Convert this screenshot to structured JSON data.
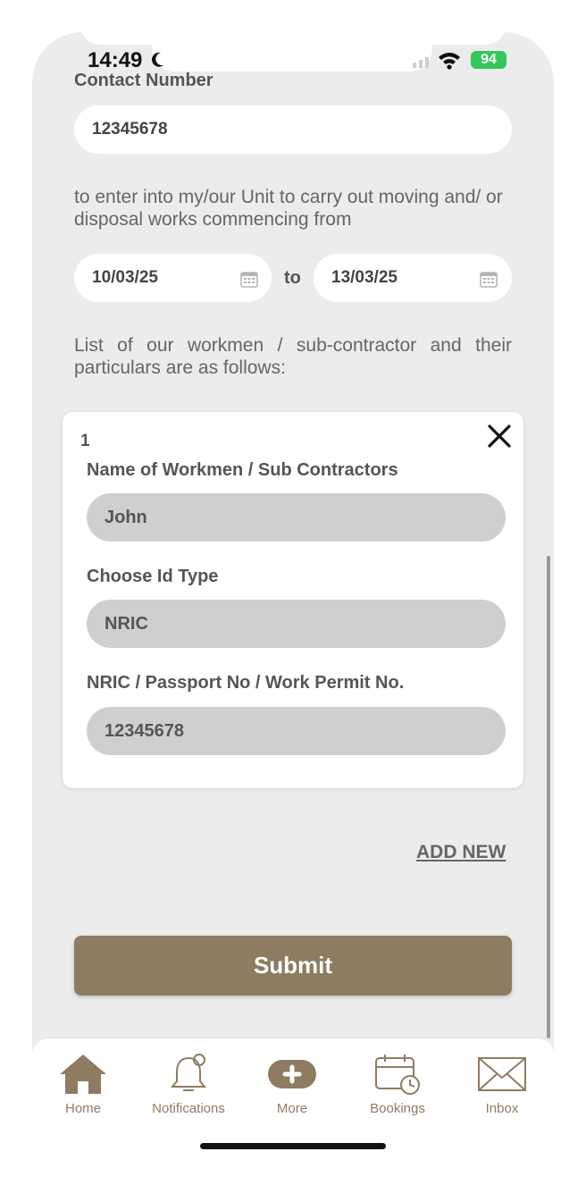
{
  "status_bar": {
    "time": "14:49",
    "battery": "94"
  },
  "form": {
    "contact_label": "Contact Number",
    "contact_value": "12345678",
    "intro_text": "to enter into my/our Unit to carry out moving and/ or disposal works commencing from",
    "date_from": "10/03/25",
    "date_to": "13/03/25",
    "to_label": "to",
    "list_text": "List of our workmen / sub-contractor and their particulars are as follows:"
  },
  "workman_card": {
    "index": "1",
    "name_label": "Name of Workmen / Sub Contractors",
    "name_value": "John",
    "id_type_label": "Choose Id Type",
    "id_type_value": "NRIC",
    "id_no_label": "NRIC / Passport No / Work Permit No.",
    "id_no_value": "12345678"
  },
  "actions": {
    "add_new": "ADD NEW",
    "submit": "Submit"
  },
  "tabbar": {
    "items": [
      {
        "label": "Home",
        "icon": "home-icon"
      },
      {
        "label": "Notifications",
        "icon": "bell-icon"
      },
      {
        "label": "More",
        "icon": "plus-pill-icon"
      },
      {
        "label": "Bookings",
        "icon": "calendar-clock-icon"
      },
      {
        "label": "Inbox",
        "icon": "envelope-icon"
      }
    ]
  },
  "colors": {
    "accent": "#8d7c62",
    "background": "#ececec",
    "battery": "#34c759"
  }
}
